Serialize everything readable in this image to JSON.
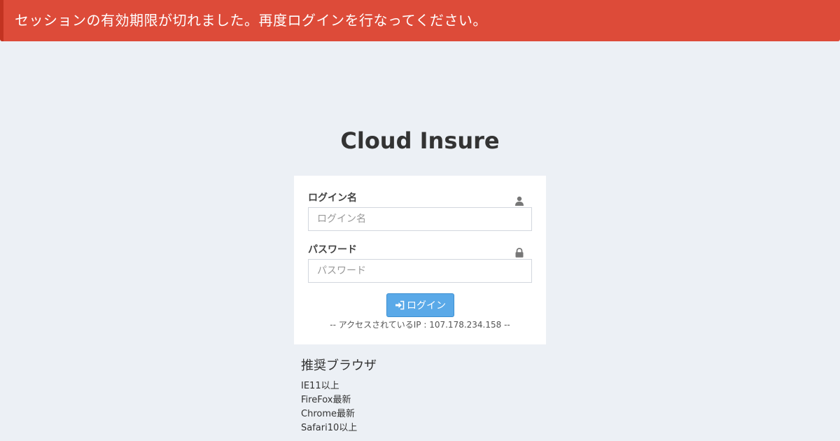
{
  "alert": {
    "message": "セッションの有効期限が切れました。再度ログインを行なってください。",
    "color": "#dd4b39"
  },
  "app": {
    "title": "Cloud Insure"
  },
  "login_form": {
    "username": {
      "label": "ログイン名",
      "placeholder": "ログイン名",
      "value": "",
      "icon": "user-icon"
    },
    "password": {
      "label": "パスワード",
      "placeholder": "パスワード",
      "value": "",
      "icon": "lock-icon"
    },
    "submit": {
      "label": "ログイン",
      "icon": "sign-in-icon",
      "color": "#5aa9e8"
    },
    "access_ip_text": "-- アクセスされているIP : 107.178.234.158 --"
  },
  "recommended_browsers": {
    "title": "推奨ブラウザ",
    "items": [
      "IE11以上",
      "FireFox最新",
      "Chrome最新",
      "Safari10以上"
    ]
  }
}
